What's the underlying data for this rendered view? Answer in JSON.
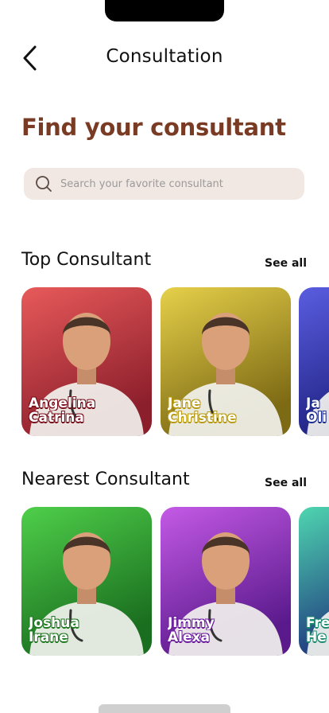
{
  "header": {
    "title": "Consultation",
    "back_icon": "chevron-left-icon"
  },
  "page_title": "Find your consultant",
  "search": {
    "placeholder": "Search your favorite consultant",
    "icon": "search-icon"
  },
  "sections": [
    {
      "title": "Top Consultant",
      "see_all": "See all",
      "cards": [
        {
          "first": "Angelina",
          "last": "Catrina",
          "bg_top": "#e85a5a",
          "bg_bottom": "#8c1f2c",
          "name_color": "#7a0f1c"
        },
        {
          "first": "Jane",
          "last": "Christine",
          "bg_top": "#e6d04a",
          "bg_bottom": "#7d6a14",
          "name_color": "#b89a10"
        },
        {
          "first": "Ja",
          "last": "Oli",
          "bg_top": "#5a5de0",
          "bg_bottom": "#1b1d7a",
          "name_color": "#1a2b8a"
        }
      ]
    },
    {
      "title": "Nearest Consultant",
      "see_all": "See all",
      "cards": [
        {
          "first": "Joshua",
          "last": "Irane",
          "bg_top": "#4fcf4a",
          "bg_bottom": "#1a6e1f",
          "name_color": "#1f7a20"
        },
        {
          "first": "Jimmy",
          "last": "Alexa",
          "bg_top": "#c45ae6",
          "bg_bottom": "#5a1a8c",
          "name_color": "#6a1a9a"
        },
        {
          "first": "Fre",
          "last": "He",
          "bg_top": "#4fd6b0",
          "bg_bottom": "#1b2a7a",
          "name_color": "#1a8a70"
        }
      ]
    }
  ]
}
